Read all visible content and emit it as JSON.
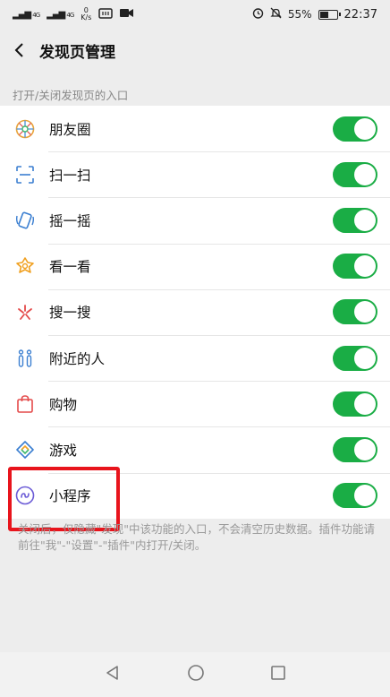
{
  "status_bar": {
    "signal1": "4G",
    "signal2": "4G",
    "net_speed_value": "0",
    "net_speed_unit": "K/s",
    "battery_percent": "55%",
    "battery_level": 0.55,
    "time": "22:37"
  },
  "header": {
    "title": "发现页管理"
  },
  "section_label": "打开/关闭发现页的入口",
  "items": [
    {
      "label": "朋友圈",
      "icon": "moments-icon",
      "enabled": true
    },
    {
      "label": "扫一扫",
      "icon": "scan-icon",
      "enabled": true
    },
    {
      "label": "摇一摇",
      "icon": "shake-icon",
      "enabled": true
    },
    {
      "label": "看一看",
      "icon": "top-stories-icon",
      "enabled": true
    },
    {
      "label": "搜一搜",
      "icon": "search-icon",
      "enabled": true
    },
    {
      "label": "附近的人",
      "icon": "people-nearby-icon",
      "enabled": true
    },
    {
      "label": "购物",
      "icon": "shopping-bag-icon",
      "enabled": true
    },
    {
      "label": "游戏",
      "icon": "games-icon",
      "enabled": true
    },
    {
      "label": "小程序",
      "icon": "mini-program-icon",
      "enabled": true
    }
  ],
  "note": "关闭后，仅隐藏\"发现\"中该功能的入口，不会清空历史数据。插件功能请前往\"我\"-\"设置\"-\"插件\"内打开/关闭。",
  "colors": {
    "toggle_on": "#1aad45",
    "highlight": "#e8141c",
    "background": "#ededed"
  }
}
